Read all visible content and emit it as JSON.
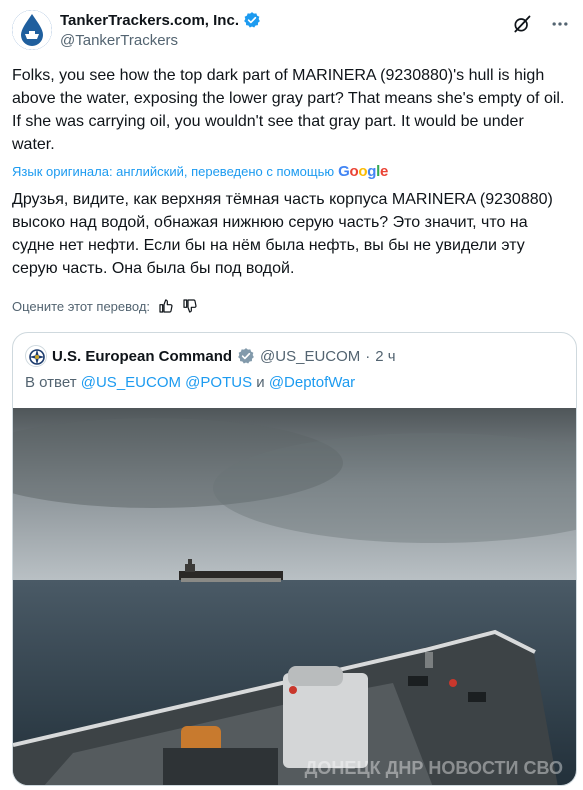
{
  "author": {
    "name": "TankerTrackers.com, Inc.",
    "handle": "@TankerTrackers"
  },
  "tweet": {
    "text": "Folks, you see how the top dark part of MARINERA (9230880)'s hull is high above the water, exposing the lower gray part? That means she's empty of oil. If she was carrying oil, you wouldn't see that gray part. It would be under water.",
    "translate_note": "Язык оригинала: английский, переведено с помощью",
    "translate_provider": "Google",
    "translation": "Друзья, видите, как верхняя тёмная часть корпуса MARINERA (9230880) высоко над водой, обнажая нижнюю серую часть? Это значит, что на судне нет нефти. Если бы на нём была нефть, вы бы не увидели эту серую часть. Она была бы под водой.",
    "rate_label": "Оцените этот перевод:"
  },
  "quote": {
    "name": "U.S. European Command",
    "handle": "@US_EUCOM",
    "separator": "·",
    "time": "2 ч",
    "reply_prefix": "В ответ",
    "reply_mention_1": "@US_EUCOM",
    "reply_mention_2": "@POTUS",
    "reply_and": "и",
    "reply_mention_3": "@DeptofWar",
    "watermark": "ДОНЕЦК ДНР НОВОСТИ СВО"
  },
  "icons": {
    "verified_personal": "verified-badge-blue-icon",
    "verified_org": "verified-badge-gray-icon",
    "grok": "grok-icon",
    "more": "more-icon",
    "thumbs_up": "thumbs-up-icon",
    "thumbs_down": "thumbs-down-icon"
  },
  "colors": {
    "text": "#0f1419",
    "secondary": "#536471",
    "link": "#1d9bf0",
    "border": "#cfd9de",
    "verified_blue": "#1d9bf0",
    "verified_gray": "#829aab"
  }
}
